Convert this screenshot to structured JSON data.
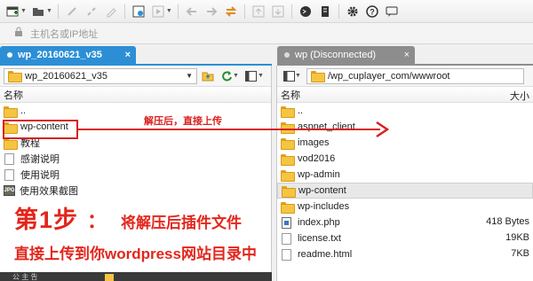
{
  "address_bar": {
    "placeholder": "主机名或IP地址"
  },
  "tabs": [
    {
      "label": "wp_20160621_v35",
      "close": "×"
    },
    {
      "label": "wp (Disconnected)",
      "close": "×"
    }
  ],
  "left_pane": {
    "path": "wp_20160621_v35",
    "col_name": "名称",
    "items": [
      {
        "name": "..",
        "icon": "folder-icon"
      },
      {
        "name": "wp-content",
        "icon": "folder-icon"
      },
      {
        "name": "教程",
        "icon": "folder-icon"
      },
      {
        "name": "感谢说明",
        "icon": "file-icon"
      },
      {
        "name": "使用说明",
        "icon": "file-icon"
      },
      {
        "name": "使用效果截图",
        "icon": "image-file-icon"
      }
    ]
  },
  "right_pane": {
    "path": "/wp_cuplayer_com/wwwroot",
    "col_name": "名称",
    "col_size": "大小",
    "items": [
      {
        "name": "..",
        "size": "",
        "icon": "folder-icon"
      },
      {
        "name": "aspnet_client",
        "size": "",
        "icon": "folder-icon"
      },
      {
        "name": "images",
        "size": "",
        "icon": "folder-icon"
      },
      {
        "name": "vod2016",
        "size": "",
        "icon": "folder-icon"
      },
      {
        "name": "wp-admin",
        "size": "",
        "icon": "folder-icon"
      },
      {
        "name": "wp-content",
        "size": "",
        "icon": "folder-icon"
      },
      {
        "name": "wp-includes",
        "size": "",
        "icon": "folder-icon"
      },
      {
        "name": "index.php",
        "size": "418 Bytes",
        "icon": "php-file-icon"
      },
      {
        "name": "license.txt",
        "size": "19KB",
        "icon": "file-icon"
      },
      {
        "name": "readme.html",
        "size": "7KB",
        "icon": "file-icon"
      }
    ]
  },
  "annotation": {
    "arrow_text": "解压后，直接上传",
    "step_label": "第1步",
    "step_colon": "：",
    "step_desc": "将解压后插件文件",
    "step_desc2": "直接上传到你wordpress网站目录中"
  },
  "status": {
    "text": "公 主 告"
  },
  "colors": {
    "accent": "#2c8fd6",
    "annotation": "#e3261c",
    "inactive_tab": "#8d8d8d",
    "folder": "#f5c542"
  }
}
